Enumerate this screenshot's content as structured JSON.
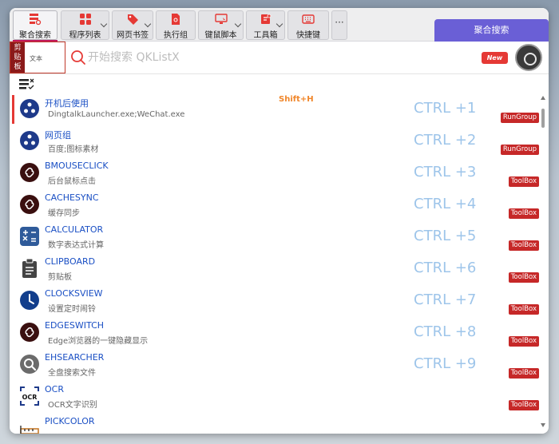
{
  "toolbar": {
    "tabs": [
      {
        "label": "聚合搜索",
        "icon": "aggregate-search-icon"
      },
      {
        "label": "程序列表",
        "icon": "grid-icon"
      },
      {
        "label": "网页书签",
        "icon": "tag-icon"
      },
      {
        "label": "执行组",
        "icon": "file-icon"
      },
      {
        "label": "键鼠脚本",
        "icon": "monitor-icon"
      },
      {
        "label": "工具箱",
        "icon": "toolbox-icon"
      },
      {
        "label": "快捷键",
        "icon": "keyboard-icon"
      }
    ],
    "more_label": "···",
    "right_tab": "聚合搜索"
  },
  "clipboard": {
    "label_chars": [
      "剪",
      "贴",
      "板"
    ],
    "text": "文本"
  },
  "search": {
    "placeholder": "开始搜索 QKListX",
    "value": ""
  },
  "badge_new": "New",
  "accent_color": "#e53935",
  "items": [
    {
      "title": "开机后使用",
      "sub": "DingtalkLauncher.exe;WeChat.exe",
      "shortcut": "CTRL +1",
      "tag": "RunGroup",
      "hotkey": "Shift+H",
      "icon": "rungroup-icon"
    },
    {
      "title": "网页组",
      "sub": "百度;图标素材",
      "shortcut": "CTRL +2",
      "tag": "RunGroup",
      "icon": "rungroup-icon"
    },
    {
      "title": "BMOUSECLICK",
      "sub": "后台鼠标点击",
      "shortcut": "CTRL +3",
      "tag": "ToolBox",
      "icon": "link-icon"
    },
    {
      "title": "CACHESYNC",
      "sub": "缓存同步",
      "shortcut": "CTRL +4",
      "tag": "ToolBox",
      "icon": "link-icon"
    },
    {
      "title": "CALCULATOR",
      "sub": "数字表达式计算",
      "shortcut": "CTRL +5",
      "tag": "ToolBox",
      "icon": "calculator-icon"
    },
    {
      "title": "CLIPBOARD",
      "sub": "剪贴板",
      "shortcut": "CTRL +6",
      "tag": "ToolBox",
      "icon": "clipboard-icon"
    },
    {
      "title": "CLOCKSVIEW",
      "sub": "设置定时闹铃",
      "shortcut": "CTRL +7",
      "tag": "ToolBox",
      "icon": "clock-icon"
    },
    {
      "title": "EDGESWITCH",
      "sub": "Edge浏览器的一键隐藏显示",
      "shortcut": "CTRL +8",
      "tag": "ToolBox",
      "icon": "link-icon"
    },
    {
      "title": "EHSEARCHER",
      "sub": "全盘搜索文件",
      "shortcut": "CTRL +9",
      "tag": "ToolBox",
      "icon": "magnifier-icon"
    },
    {
      "title": "OCR",
      "sub": "OCR文字识别",
      "shortcut": "",
      "tag": "ToolBox",
      "icon": "ocr-icon"
    },
    {
      "title": "PICKCOLOR",
      "sub": "",
      "shortcut": "",
      "tag": "",
      "icon": "ruler-icon"
    }
  ]
}
